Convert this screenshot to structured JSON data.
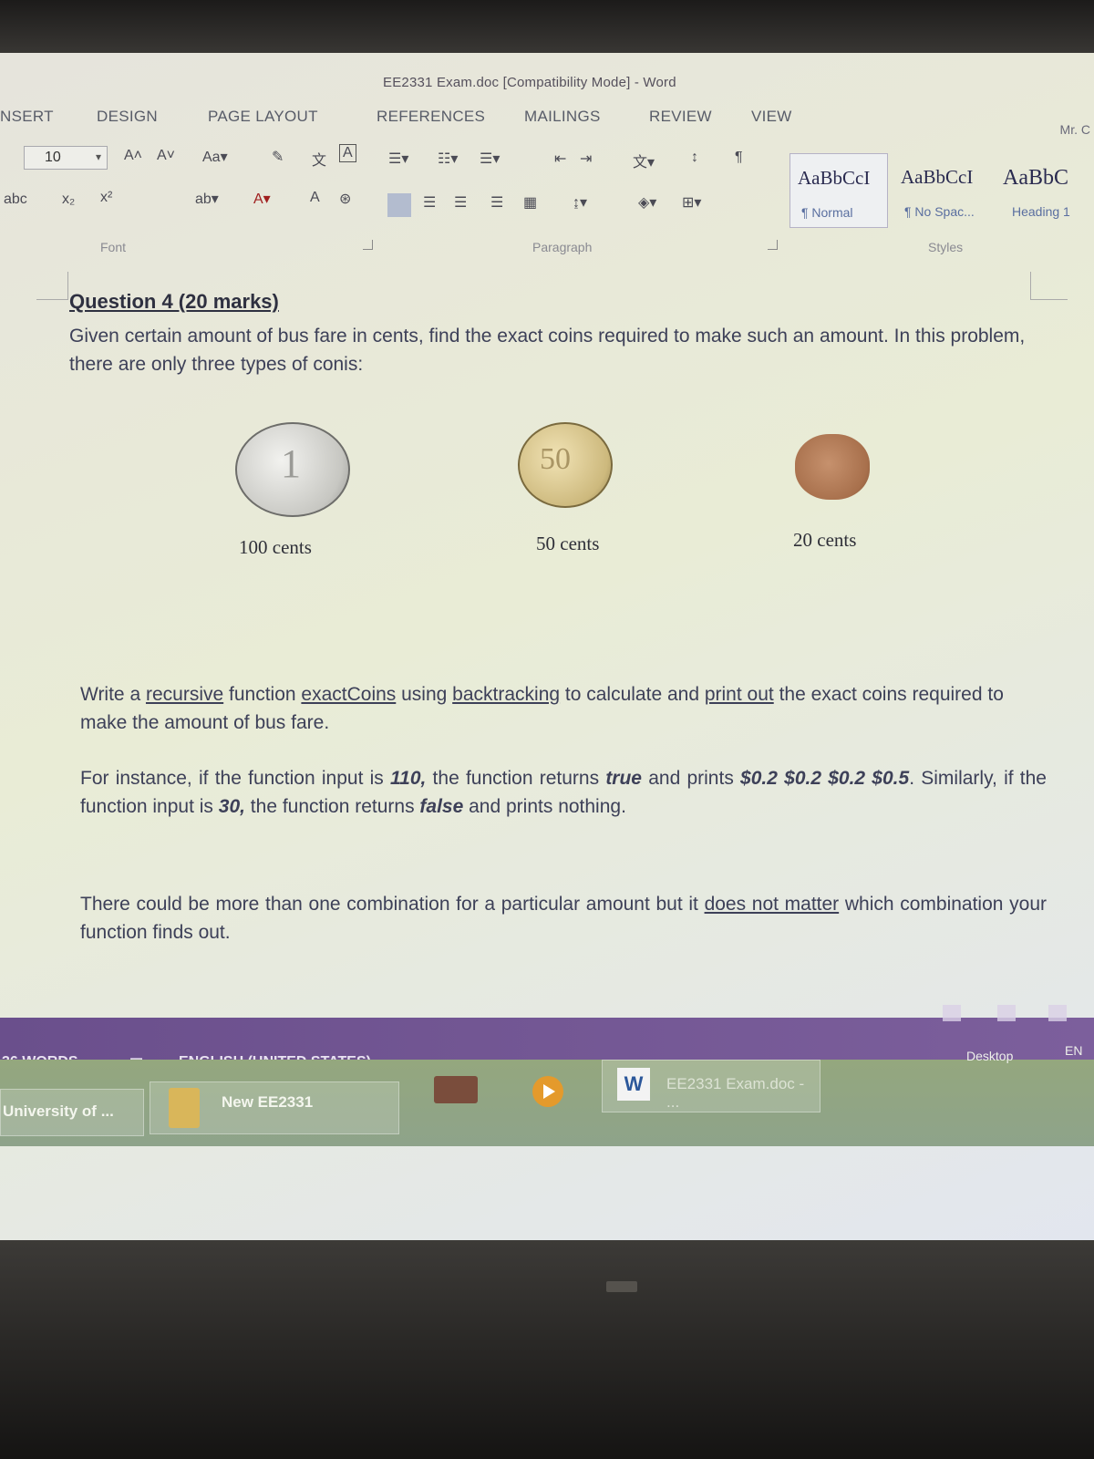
{
  "window": {
    "title": "EE2331 Exam.doc [Compatibility Mode] - Word",
    "account": "Mr. C"
  },
  "tabs": [
    "NSERT",
    "DESIGN",
    "PAGE LAYOUT",
    "REFERENCES",
    "MAILINGS",
    "REVIEW",
    "VIEW"
  ],
  "ribbon": {
    "font_size": "10",
    "group_labels": {
      "font": "Font",
      "paragraph": "Paragraph",
      "styles": "Styles"
    },
    "styles": [
      {
        "sample": "AaBbCcI",
        "name": "¶ Normal"
      },
      {
        "sample": "AaBbCcI",
        "name": "¶ No Spac..."
      },
      {
        "sample": "AaBbC",
        "name": "Heading 1"
      }
    ]
  },
  "document": {
    "question_title": "Question 4 (20 marks)",
    "intro": "Given certain amount of bus fare in cents, find the exact coins required to make such an amount. In this problem, there are only three types of conis:",
    "coins": [
      {
        "label": "100 cents",
        "face": "1"
      },
      {
        "label": "50 cents",
        "face": "50"
      },
      {
        "label": "20 cents",
        "face": ""
      }
    ],
    "p1": {
      "t1": "Write a ",
      "u1": "recursive",
      "t2": " function ",
      "u2": "exactCoins",
      "t3": " using ",
      "u3": "backtracking",
      "t4": " to calculate and ",
      "u4": "print out",
      "t5": " the exact coins required to make the amount of bus fare."
    },
    "p2": {
      "t1": "For instance, if the function input is ",
      "b1": "110,",
      "t2": " the function returns ",
      "b2": "true",
      "t3": " and prints ",
      "b3": "$0.2 $0.2 $0.2 $0.5",
      "t4": ". Similarly, if the function input is ",
      "b4": "30,",
      "t5": " the function returns ",
      "b5": "false",
      "t6": " and prints nothing."
    },
    "p3": {
      "t1": "There could be more than one combination for a particular amount but it ",
      "u1": "does not matter",
      "t2": " which combination your function finds out."
    }
  },
  "status_bar": {
    "words": "36 WORDS",
    "language": "ENGLISH (UNITED STATES)"
  },
  "taskbar": {
    "item_university": "University of ...",
    "item_folder": "New EE2331",
    "item_word": "EE2331 Exam.doc - ...",
    "desktop": "Desktop",
    "lang": "EN"
  },
  "colors": {
    "statusbar": "#6a4f8c",
    "taskbar": "#94a77e",
    "word_blue": "#2b579a"
  }
}
